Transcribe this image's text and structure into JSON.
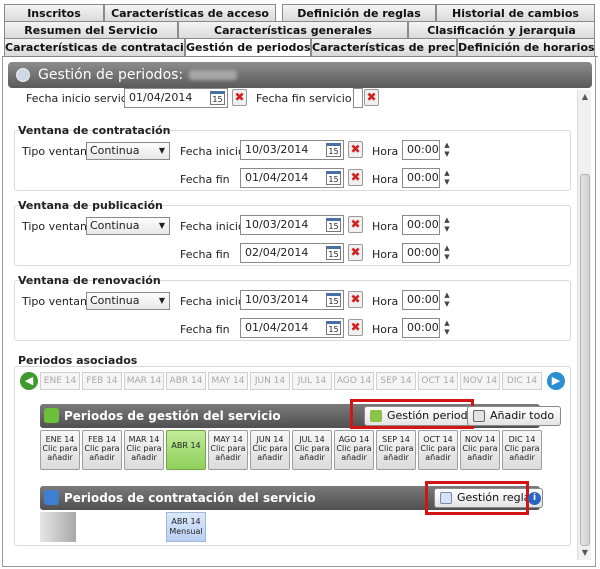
{
  "tabs_row1": [
    "Inscritos",
    "Características de acceso",
    "Definición de reglas",
    "Historial de cambios"
  ],
  "tabs_row2": [
    "Resumen del Servicio",
    "Características generales",
    "Clasificación y jerarquia"
  ],
  "tabs_row3": [
    "Características de contratació...",
    "Gestión de periodos",
    "Características de precio",
    "Definición de horarios"
  ],
  "header": {
    "title": "Gestión de periodos:"
  },
  "service": {
    "fecha_inicio_label": "Fecha inicio servicio",
    "fecha_inicio_value": "01/04/2014",
    "fecha_fin_label": "Fecha fin servicio"
  },
  "windows": [
    {
      "title": "Ventana de contratación",
      "tipo_label": "Tipo ventana",
      "tipo_value": "Continua",
      "inicio_label": "Fecha inicio",
      "inicio_value": "10/03/2014",
      "fin_label": "Fecha fin",
      "fin_value": "01/04/2014",
      "hora_label": "Hora",
      "hora1": "00:00",
      "hora2": "00:00"
    },
    {
      "title": "Ventana de publicación",
      "tipo_label": "Tipo ventana",
      "tipo_value": "Continua",
      "inicio_label": "Fecha inicio",
      "inicio_value": "10/03/2014",
      "fin_label": "Fecha fin",
      "fin_value": "02/04/2014",
      "hora_label": "Hora",
      "hora1": "00:00",
      "hora2": "00:00"
    },
    {
      "title": "Ventana de renovación",
      "tipo_label": "Tipo ventana",
      "tipo_value": "Continua",
      "inicio_label": "Fecha inicio",
      "inicio_value": "10/03/2014",
      "fin_label": "Fecha fin",
      "fin_value": "01/04/2014",
      "hora_label": "Hora",
      "hora1": "00:00",
      "hora2": "00:00"
    }
  ],
  "periodos": {
    "title": "Periodos asociados",
    "months": [
      "ENE 14",
      "FEB 14",
      "MAR 14",
      "ABR 14",
      "MAY 14",
      "JUN 14",
      "JUL 14",
      "AGO 14",
      "SEP 14",
      "OCT 14",
      "NOV 14",
      "DIC 14"
    ],
    "gestion_title": "Periodos de gestión del servicio",
    "gestion_button": "Gestión periodos",
    "anadir_button": "Añadir todo",
    "cell_hint": "Clic para añadir",
    "active_month": "ABR 14",
    "contratacion_title": "Periodos de contratación del servicio",
    "reglas_button": "Gestión reglas",
    "contract_month": "ABR 14",
    "contract_type": "Mensual"
  },
  "colors": {
    "accent_green": "#8fd05a",
    "highlight_red": "#d21414",
    "header_gray": "#6a6a6a"
  }
}
